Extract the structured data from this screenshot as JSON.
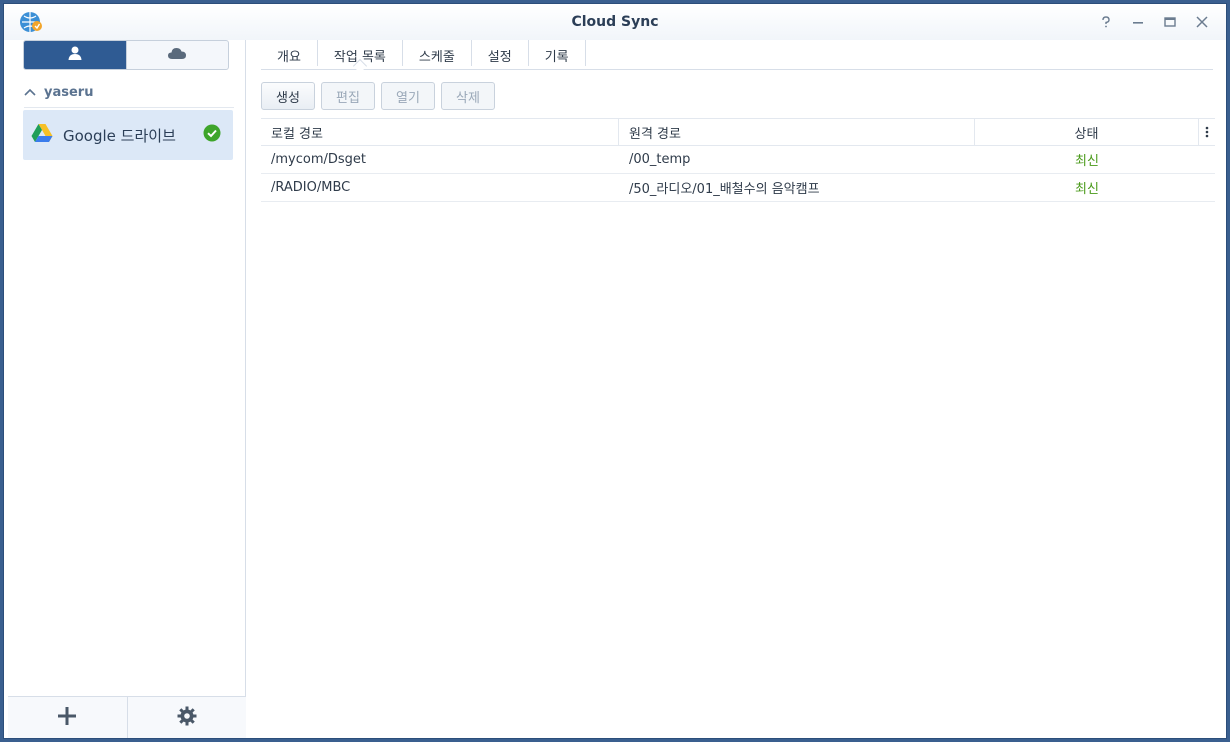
{
  "window": {
    "title": "Cloud Sync",
    "controls": [
      "help-icon",
      "minimize-icon",
      "maximize-icon",
      "close-icon"
    ]
  },
  "sidebar": {
    "segments": [
      "user-icon",
      "cloud-icon"
    ],
    "group": {
      "label": "yaseru"
    },
    "accounts": [
      {
        "name": "Google 드라이브",
        "icon": "google-drive-icon",
        "status_icon": "check-circle-icon"
      }
    ],
    "footer": [
      "plus-icon",
      "gear-icon"
    ]
  },
  "main": {
    "tabs": [
      {
        "label": "개요"
      },
      {
        "label": "작업 목록"
      },
      {
        "label": "스케줄"
      },
      {
        "label": "설정"
      },
      {
        "label": "기록"
      }
    ],
    "toolbar": {
      "create": "생성",
      "edit": "편집",
      "open": "열기",
      "delete": "삭제"
    },
    "table": {
      "headers": {
        "local": "로컬 경로",
        "remote": "원격 경로",
        "status": "상태"
      },
      "rows": [
        {
          "local": "/mycom/Dsget",
          "remote": "/00_temp",
          "status": "최신"
        },
        {
          "local": "/RADIO/MBC",
          "remote": "/50_라디오/01_배철수의 음악캠프",
          "status": "최신"
        }
      ]
    }
  },
  "colors": {
    "accent": "#2f5b93",
    "status_ok": "#4a9a1a",
    "selected_bg": "#dce8f7"
  }
}
